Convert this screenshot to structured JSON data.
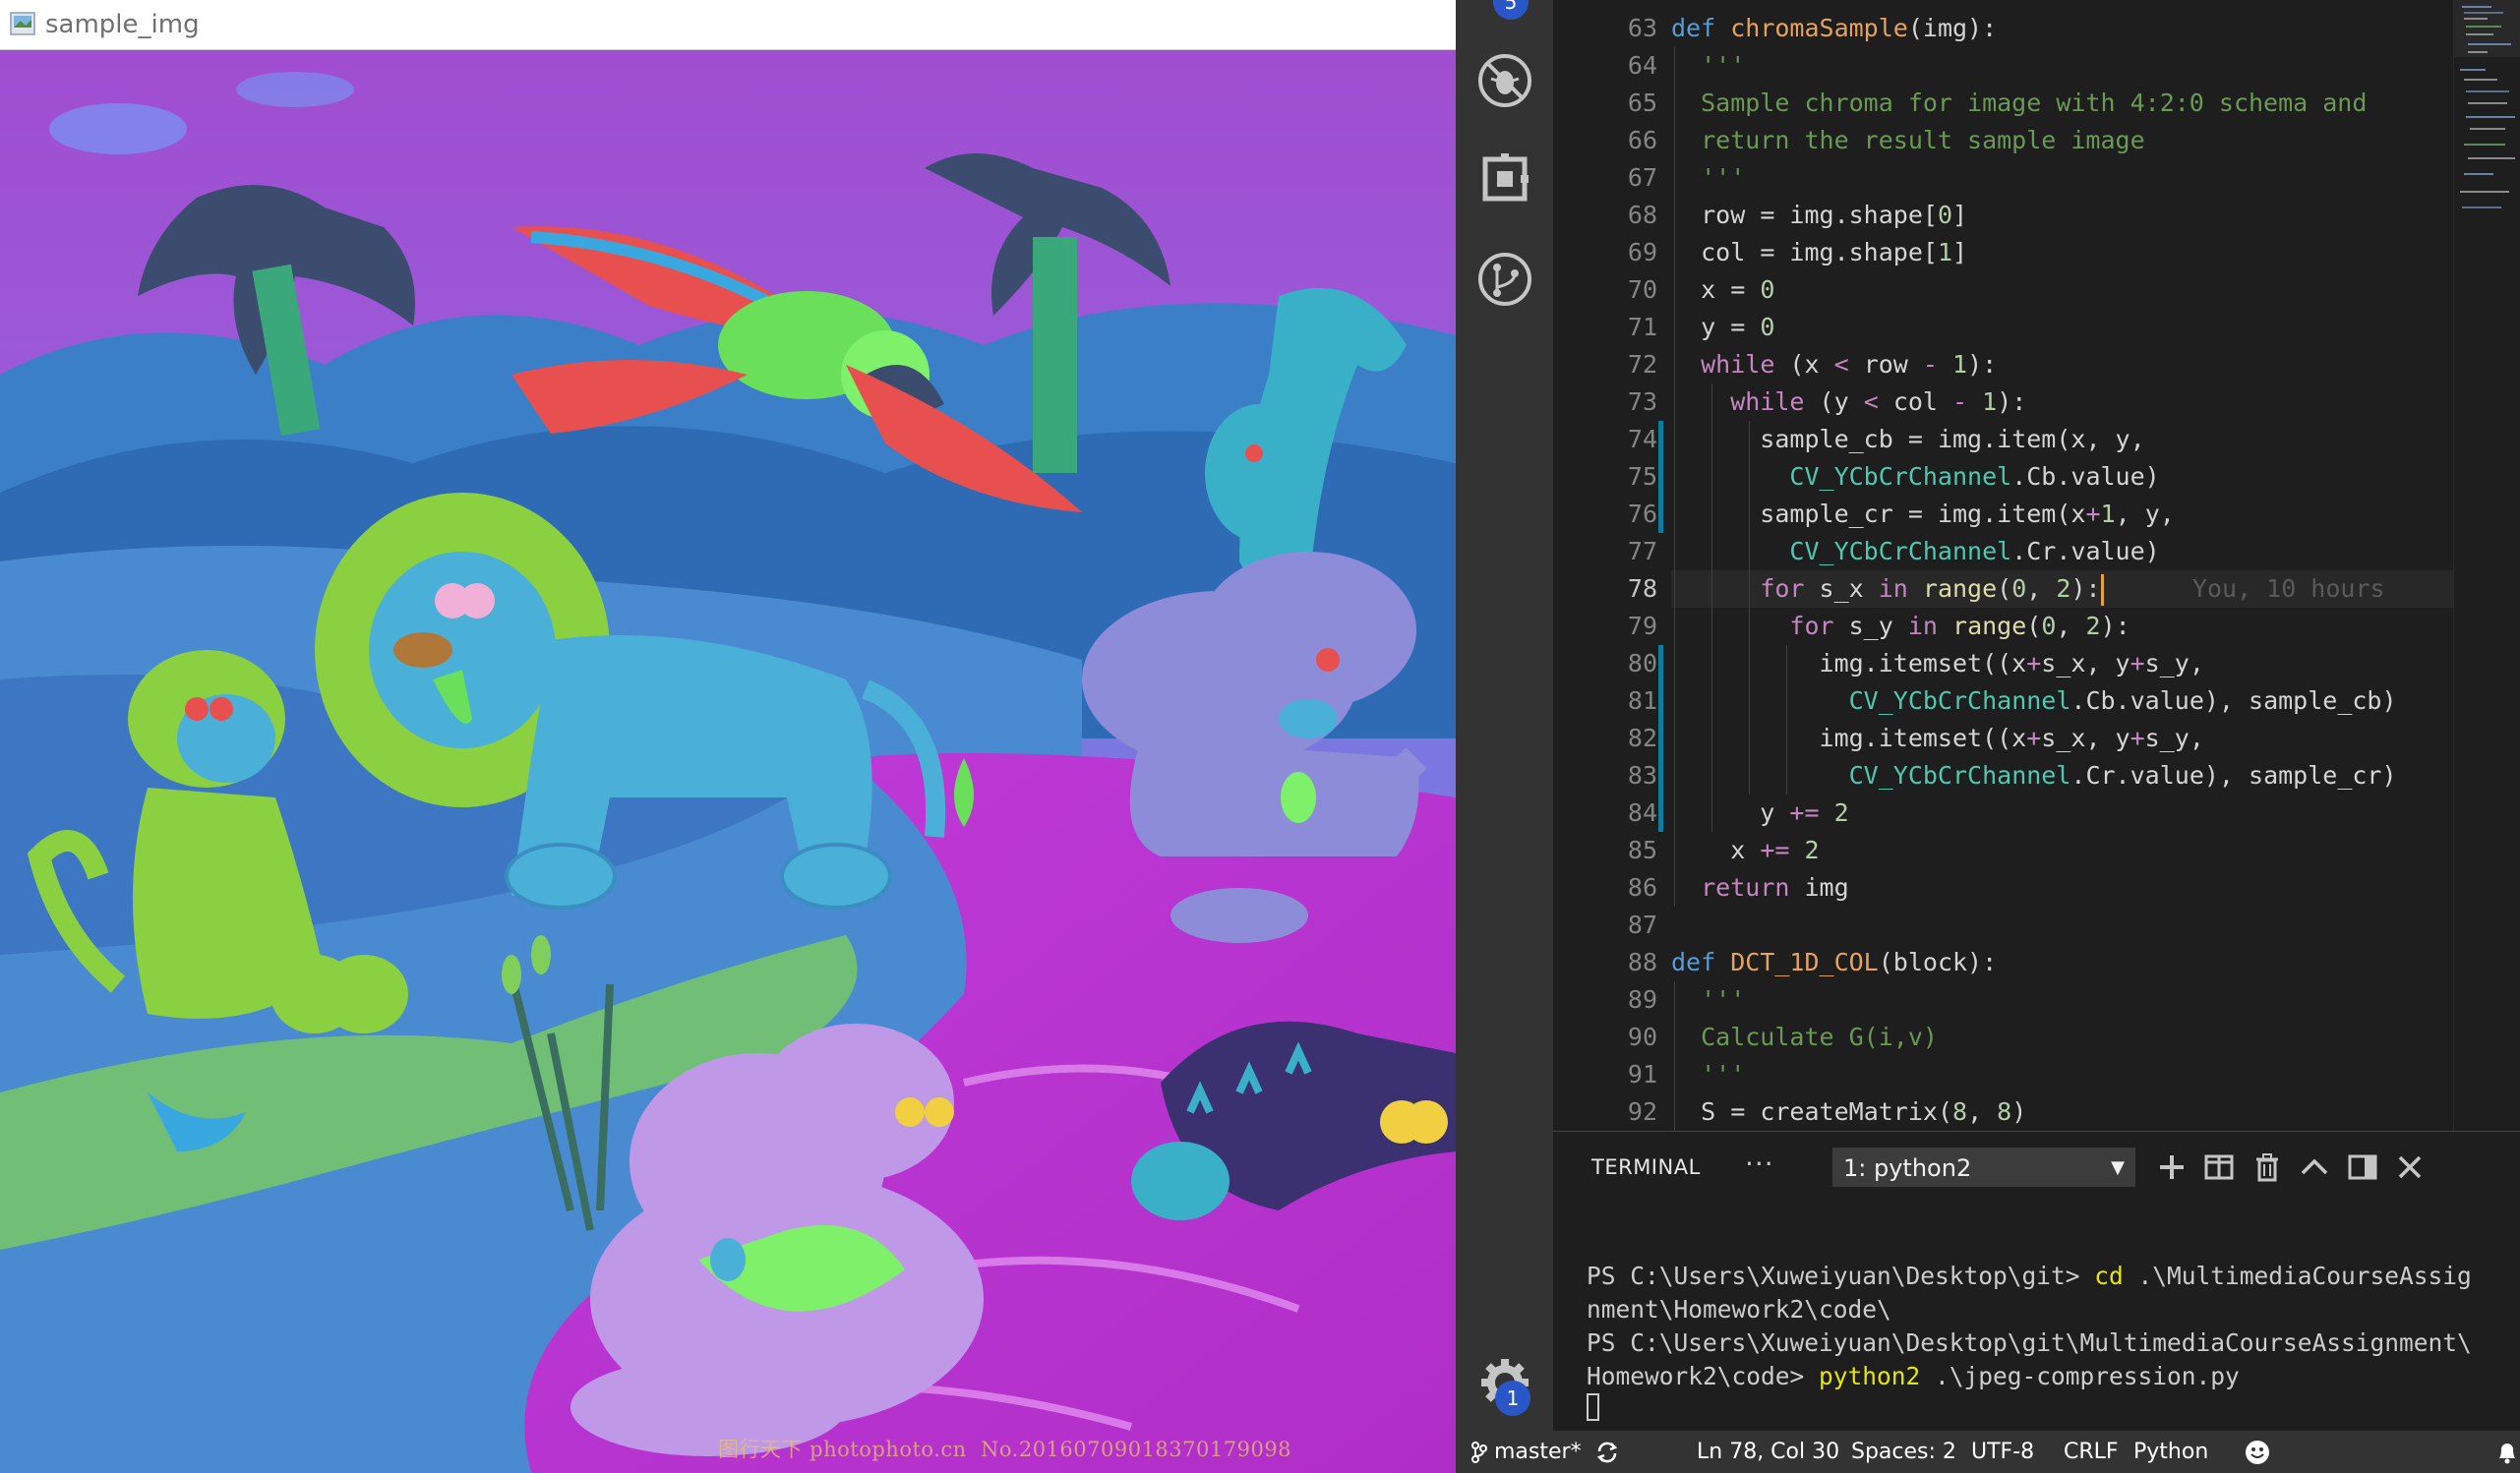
{
  "viewer": {
    "title": "sample_img",
    "watermark": "图行天下 photophoto.cn  No.20160709018370179098"
  },
  "activity_bar": {
    "top_badge": "5",
    "settings_badge": "1",
    "icons": [
      "no-bug-debug-icon",
      "extensions-icon",
      "git-icon",
      "gear-icon"
    ]
  },
  "editor": {
    "line_numbers": [
      "63",
      "64",
      "65",
      "66",
      "67",
      "68",
      "69",
      "70",
      "71",
      "72",
      "73",
      "74",
      "75",
      "76",
      "77",
      "78",
      "79",
      "80",
      "81",
      "82",
      "83",
      "84",
      "85",
      "86",
      "87",
      "88",
      "89",
      "90",
      "91",
      "92"
    ],
    "active_line": "78",
    "blame": "You, 10 hours",
    "lines": [
      "def chromaSample(img):",
      "  '''",
      "  Sample chroma for image with 4:2:0 schema and",
      "  return the result sample image",
      "  '''",
      "  row = img.shape[0]",
      "  col = img.shape[1]",
      "  x = 0",
      "  y = 0",
      "  while (x < row - 1):",
      "    while (y < col - 1):",
      "      sample_cb = img.item(x, y,",
      "        CV_YCbCrChannel.Cb.value)",
      "      sample_cr = img.item(x+1, y,",
      "        CV_YCbCrChannel.Cr.value)",
      "      for s_x in range(0, 2):",
      "        for s_y in range(0, 2):",
      "          img.itemset((x+s_x, y+s_y,",
      "            CV_YCbCrChannel.Cb.value), sample_cb)",
      "          img.itemset((x+s_x, y+s_y,",
      "            CV_YCbCrChannel.Cr.value), sample_cr)",
      "      y += 2",
      "    x += 2",
      "  return img",
      "",
      "def DCT_1D_COL(block):",
      "  '''",
      "  Calculate G(i,v)",
      "  '''",
      "  S = createMatrix(8, 8)"
    ]
  },
  "terminal": {
    "tab_label": "TERMINAL",
    "more_label": "···",
    "selected_shell": "1: python2",
    "prompt1": "PS C:\\Users\\Xuweiyuan\\Desktop\\git> ",
    "cmd1": "cd",
    "arg1": " .\\MultimediaCourseAssig",
    "arg1b": "nment\\Homework2\\code\\",
    "prompt2a": "PS C:\\Users\\Xuweiyuan\\Desktop\\git\\MultimediaCourseAssignment\\",
    "prompt2b": "Homework2\\code> ",
    "cmd2": "python2",
    "arg2": " .\\jpeg-compression.py"
  },
  "statusbar": {
    "branch": "master*",
    "position": "Ln 78, Col 30",
    "spaces": "Spaces: 2",
    "encoding": "UTF-8",
    "eol": "CRLF",
    "language": "Python"
  },
  "colors": {
    "vscode_bg": "#1e1e1e",
    "activity_bar": "#333333",
    "status_bar": "#333333",
    "keyword": "#569cd6",
    "control": "#c586c0",
    "function_def": "#e5a35d",
    "class": "#4ec9b0",
    "number": "#b5cea8",
    "docstring": "#6a9955",
    "badge": "#2a57c8"
  }
}
